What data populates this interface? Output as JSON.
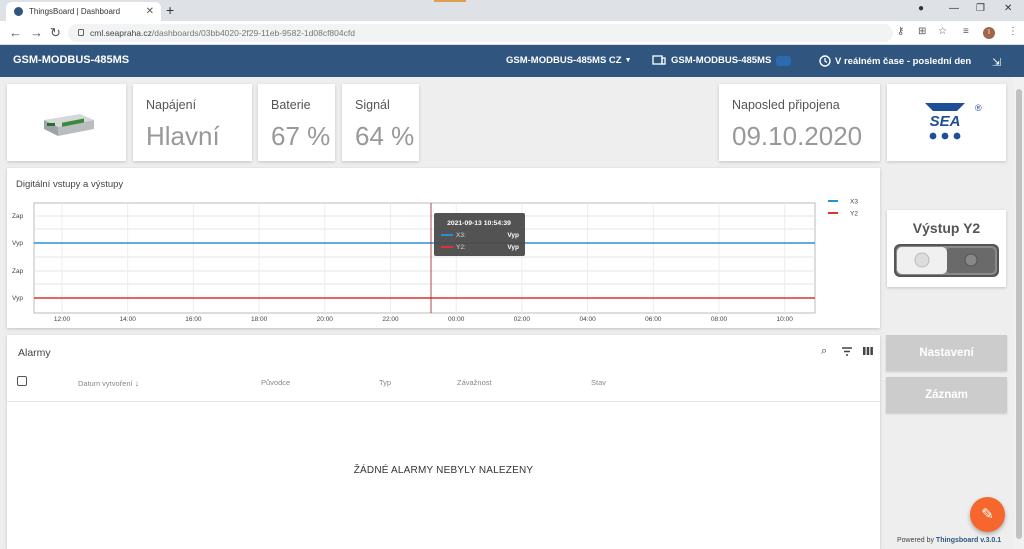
{
  "browser": {
    "tab_title": "ThingsBoard | Dashboard",
    "url_host": "cml.seapraha.cz",
    "url_path": "/dashboards/03bb4020-2f29-11eb-9582-1d08cf804cfd",
    "profile_initial": "I"
  },
  "header": {
    "title": "GSM-MODBUS-485MS",
    "entity_select": "GSM-MODBUS-485MS CZ",
    "entity_state": "GSM-MODBUS-485MS",
    "timewindow": "V reálném čase - poslední den"
  },
  "kpis": [
    {
      "label": "Napájení",
      "value": "Hlavní"
    },
    {
      "label": "Baterie",
      "value": "67 %"
    },
    {
      "label": "Signál",
      "value": "64 %"
    }
  ],
  "last_connected": {
    "label": "Naposled připojena",
    "value": "09.10.2020"
  },
  "logo": {
    "text": "SEA",
    "mark": "®"
  },
  "chart_data": {
    "type": "line",
    "title": "Digitální vstupy a výstupy",
    "x_ticks": [
      "12:00",
      "14:00",
      "16:00",
      "18:00",
      "20:00",
      "22:00",
      "00:00",
      "02:00",
      "04:00",
      "06:00",
      "08:00",
      "10:00"
    ],
    "y_ticks": [
      "Vyp",
      "Zap",
      "Vyp",
      "Zap"
    ],
    "series": [
      {
        "name": "X3",
        "color": "#2b8fd6",
        "values": [
          "Vyp"
        ]
      },
      {
        "name": "Y2",
        "color": "#d9362f",
        "values": [
          "Vyp"
        ]
      }
    ],
    "tooltip": {
      "time": "2021-09-13 10:54:39",
      "rows": [
        {
          "name": "X3:",
          "value": "Vyp",
          "color": "#2b8fd6"
        },
        {
          "name": "Y2:",
          "value": "Vyp",
          "color": "#d9362f"
        }
      ]
    }
  },
  "switch": {
    "title": "Výstup Y2",
    "state": "off"
  },
  "buttons": {
    "settings": "Nastavení",
    "record": "Záznam"
  },
  "alarms": {
    "title": "Alarmy",
    "columns": [
      "Datum vytvoření",
      "Původce",
      "Typ",
      "Závažnost",
      "Stav"
    ],
    "empty": "ŽÁDNÉ ALARMY NEBYLY NALEZENY"
  },
  "footer": {
    "powered": "Powered by",
    "brand": "Thingsboard v.3.0.1"
  }
}
